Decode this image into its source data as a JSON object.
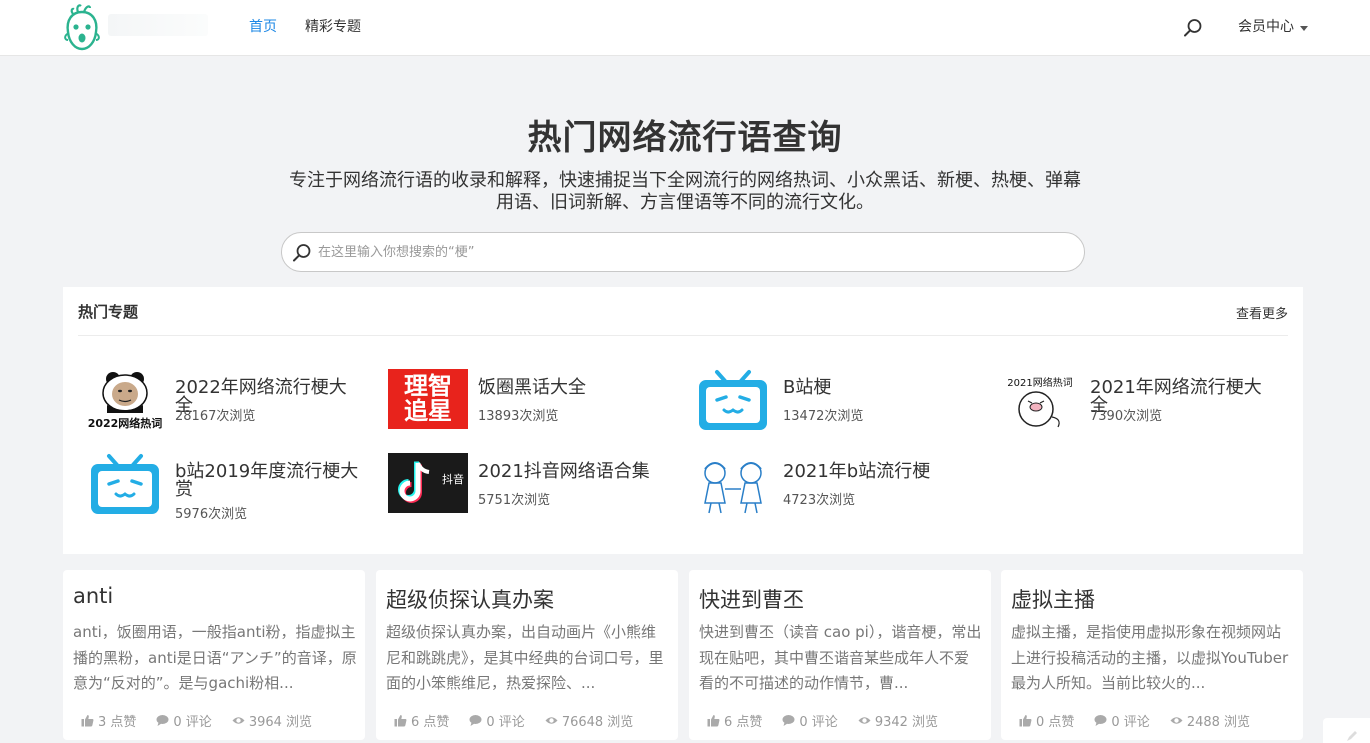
{
  "header": {
    "nav": [
      "首页",
      "精彩专题"
    ],
    "member_label": "会员中心"
  },
  "hero": {
    "title": "热门网络流行语查询",
    "description": "专注于网络流行语的收录和解释，快速捕捉当下全网流行的网络热词、小众黑话、新梗、热梗、弹幕用语、旧词新解、方言俚语等不同的流行文化。",
    "search_placeholder": "在这里输入你想搜索的“梗”"
  },
  "topics_panel": {
    "title": "热门专题",
    "more": "查看更多",
    "items": [
      {
        "name": "2022年网络流行梗大全",
        "views": "28167次浏览",
        "thumb": "panda-meme",
        "thumb_text": "2022网络热词"
      },
      {
        "name": "饭圈黑话大全",
        "views": "13893次浏览",
        "thumb": "text-logo",
        "thumb_text": "理智追星"
      },
      {
        "name": "B站梗",
        "views": "13472次浏览",
        "thumb": "bilibili-tv-icon"
      },
      {
        "name": "2021年网络流行梗大全",
        "views": "7390次浏览",
        "thumb": "cartoon-meme",
        "thumb_text": "2021网络热词"
      },
      {
        "name": "b站2019年度流行梗大赏",
        "views": "5976次浏览",
        "thumb": "bilibili-tv-icon"
      },
      {
        "name": "2021抖音网络语合集",
        "views": "5751次浏览",
        "thumb": "douyin-logo",
        "thumb_text": "抖音"
      },
      {
        "name": "2021年b站流行梗",
        "views": "4723次浏览",
        "thumb": "anime-sketch"
      }
    ]
  },
  "cards": [
    {
      "title": "anti",
      "desc": "anti，饭圈用语，一般指anti粉，指虚拟主播的黑粉，anti是日语“アンチ”的音译，原意为“反对的”。是与gachi粉相...",
      "likes": "3 点赞",
      "comments": "0 评论",
      "views": "3964 浏览"
    },
    {
      "title": "超级侦探认真办案",
      "desc": "超级侦探认真办案，出自动画片《小熊维尼和跳跳虎》，是其中经典的台词口号，里面的小笨熊维尼，热爱探险、...",
      "likes": "6 点赞",
      "comments": "0 评论",
      "views": "76648 浏览"
    },
    {
      "title": "快进到曹丕",
      "desc": "快进到曹丕（读音 cao pi），谐音梗，常出现在贴吧，其中曹丕谐音某些成年人不爱看的不可描述的动作情节，曹...",
      "likes": "6 点赞",
      "comments": "0 评论",
      "views": "9342 浏览"
    },
    {
      "title": "虚拟主播",
      "desc": "虚拟主播，是指使用虚拟形象在视频网站上进行投稿活动的主播，以虚拟YouTuber最为人所知。当前比较火的...",
      "likes": "0 点赞",
      "comments": "0 评论",
      "views": "2488 浏览"
    }
  ],
  "colors": {
    "accent": "#1e88e5",
    "bilibili": "#23ade5",
    "logo_green": "#2bb38f",
    "text_logo_red": "#e8231c"
  }
}
